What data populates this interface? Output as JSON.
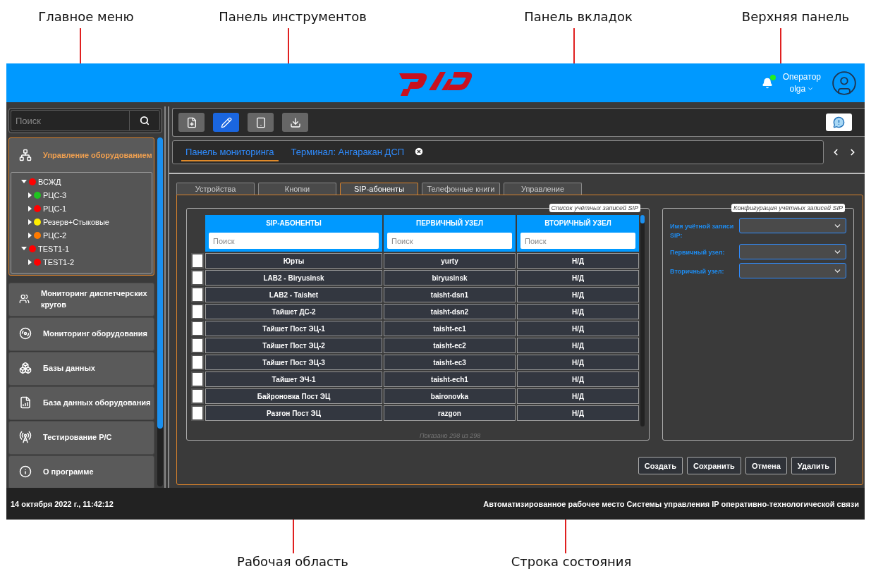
{
  "annotations": {
    "top": [
      "Главное меню",
      "Панель инструментов",
      "Панель вкладок",
      "Верхняя панель"
    ],
    "bottom": [
      "Рабочая область",
      "Строка состояния"
    ]
  },
  "header": {
    "unread": true,
    "user_role": "Оператор",
    "user_name": "olga"
  },
  "sidebar": {
    "search": {
      "placeholder": "Поиск"
    },
    "menu": [
      {
        "kind": "equipment",
        "label": "Управление оборудованием",
        "selected": true,
        "tree": [
          {
            "label": "ВСЖД",
            "color": "#ff0000",
            "expanded": true,
            "children": [
              {
                "label": "РЦС-3",
                "color": "#1fc31f",
                "expanded": false
              },
              {
                "label": "РЦС-1",
                "color": "#ff0000",
                "expanded": false
              },
              {
                "label": "Резерв+Стыковые",
                "color": "#ffee00",
                "expanded": false
              },
              {
                "label": "РЦС-2",
                "color": "#ff7a00",
                "expanded": false
              }
            ]
          },
          {
            "label": "TEST1-1",
            "color": "#ff0000",
            "expanded": true,
            "children": [
              {
                "label": "TEST1-2",
                "color": "#ff0000",
                "expanded": false
              }
            ]
          }
        ]
      },
      {
        "kind": "dispatch",
        "label": "Мониторинг диспетчерских кругов",
        "selected": false
      },
      {
        "kind": "monitoring",
        "label": "Мониторинг оборудования",
        "selected": false
      },
      {
        "kind": "databases",
        "label": "Базы данных",
        "selected": false
      },
      {
        "kind": "equipment_db",
        "label": "База данных оборудования",
        "selected": false
      },
      {
        "kind": "radio",
        "label": "Тестирование Р/С",
        "selected": false
      },
      {
        "kind": "about",
        "label": "О программе",
        "selected": false
      }
    ]
  },
  "toolbar": {
    "buttons": [
      {
        "kind": "new",
        "selected": false
      },
      {
        "kind": "edit",
        "selected": true
      },
      {
        "kind": "frame",
        "selected": false
      },
      {
        "kind": "download",
        "selected": false
      }
    ]
  },
  "tabs": [
    {
      "label": "Панель мониторинга",
      "selected": true,
      "closable": false
    },
    {
      "label": "Терминал: Ангаракан ДСП",
      "selected": false,
      "closable": true
    }
  ],
  "subtabs": [
    {
      "label": "Устройства",
      "selected": false
    },
    {
      "label": "Кнопки",
      "selected": false
    },
    {
      "label": "SIP-абоненты",
      "selected": true
    },
    {
      "label": "Телефонные книги",
      "selected": false
    },
    {
      "label": "Управление",
      "selected": false
    }
  ],
  "sip_list": {
    "title": "Список учётных записей SIP",
    "columns": [
      "SIP-АБОНЕНТЫ",
      "ПЕРВИЧНЫЙ УЗЕЛ",
      "ВТОРИЧНЫЙ УЗЕЛ"
    ],
    "search_placeholders": [
      "Поиск",
      "Поиск",
      "Поиск"
    ],
    "rows": [
      {
        "checked": false,
        "cells": [
          "Юрты",
          "yurty",
          "Н/Д"
        ]
      },
      {
        "checked": false,
        "cells": [
          "LAB2 - Biryusinsk",
          "biryusinsk",
          "Н/Д"
        ]
      },
      {
        "checked": false,
        "cells": [
          "LAB2 - Taishet",
          "taisht-dsn1",
          "Н/Д"
        ]
      },
      {
        "checked": false,
        "cells": [
          "Тайшет ДС-2",
          "taisht-dsn2",
          "Н/Д"
        ]
      },
      {
        "checked": false,
        "cells": [
          "Тайшет Пост ЭЦ-1",
          "taisht-ec1",
          "Н/Д"
        ]
      },
      {
        "checked": false,
        "cells": [
          "Тайшет Пост ЭЦ-2",
          "taisht-ec2",
          "Н/Д"
        ]
      },
      {
        "checked": false,
        "cells": [
          "Тайшет Пост ЭЦ-3",
          "taisht-ec3",
          "Н/Д"
        ]
      },
      {
        "checked": false,
        "cells": [
          "Тайшет ЭЧ-1",
          "taisht-ech1",
          "Н/Д"
        ]
      },
      {
        "checked": false,
        "cells": [
          "Байроновка Пост ЭЦ",
          "baironovka",
          "Н/Д"
        ]
      },
      {
        "checked": false,
        "cells": [
          "Разгон Пост ЭЦ",
          "razgon",
          "Н/Д"
        ]
      }
    ],
    "footer": "Показано 298 из 298"
  },
  "config": {
    "title": "Конфигурация учётных записей SIP",
    "fields": [
      {
        "label": "Имя учётной записи SIP:"
      },
      {
        "label": "Первичный узел:"
      },
      {
        "label": "Вторичный узел:"
      }
    ]
  },
  "actions": [
    "Создать",
    "Сохранить",
    "Отмена",
    "Удалить"
  ],
  "status_bar": {
    "datetime": "14 октября 2022 г., 11:42:12",
    "title": "Автоматизированное рабочее место Системы управления IP оперативно-технологической связи"
  }
}
